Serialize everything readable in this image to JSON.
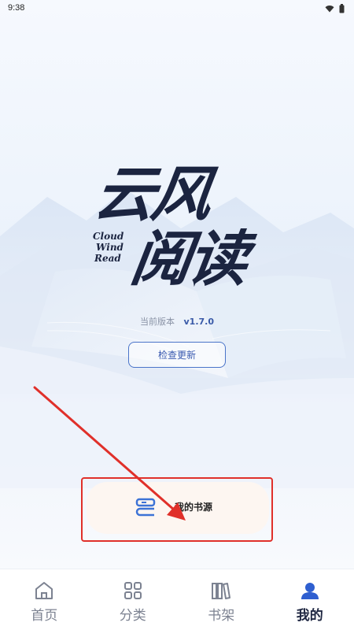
{
  "status_bar": {
    "time": "9:38"
  },
  "logo": {
    "cn_line1": "云风",
    "cn_line2": "阅读",
    "en_lines": [
      "Cloud",
      "Wind",
      "Read"
    ]
  },
  "version": {
    "label": "当前版本",
    "value": "v1.7.0"
  },
  "check_update": {
    "label": "检查更新"
  },
  "source_card": {
    "label": "我的书源",
    "icon": "book-source-icon"
  },
  "bottom_nav": {
    "items": [
      {
        "label": "首页",
        "icon": "home-icon",
        "active": false
      },
      {
        "label": "分类",
        "icon": "grid-icon",
        "active": false
      },
      {
        "label": "书架",
        "icon": "bookshelf-icon",
        "active": false
      },
      {
        "label": "我的",
        "icon": "user-icon",
        "active": true
      }
    ]
  },
  "colors": {
    "accent": "#4a74c9",
    "annotation_red": "#e0302a",
    "nav_active": "#1f2742",
    "nav_inactive": "#7c8291"
  }
}
